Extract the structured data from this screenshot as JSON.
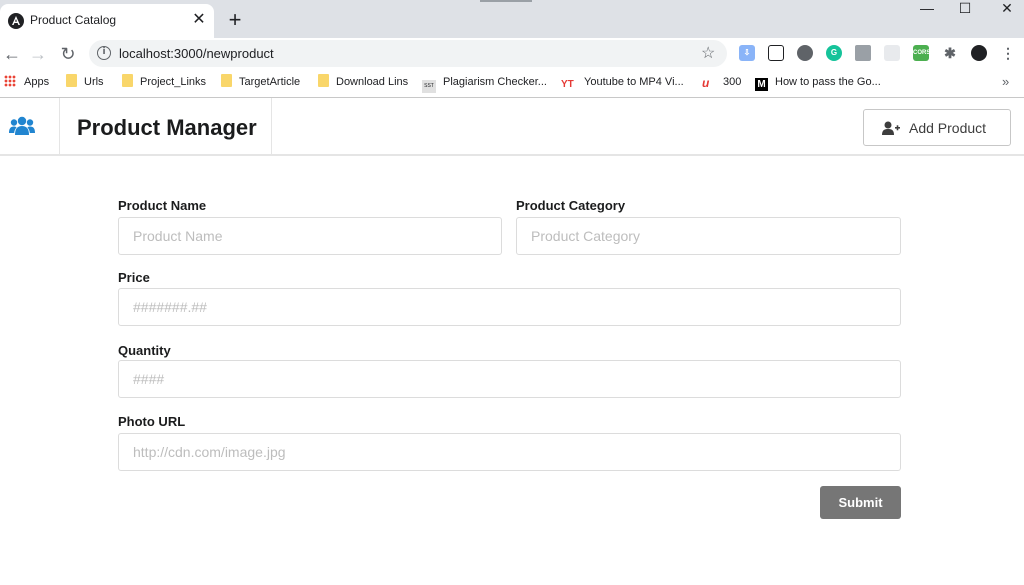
{
  "browser": {
    "tab_title": "Product Catalog",
    "tab_close": "✕",
    "new_tab": "+",
    "url": "localhost:3000/newproduct",
    "window_controls": {
      "minimize": "—",
      "maximize": "☐",
      "close": "✕"
    },
    "bookmarks": [
      {
        "label": "Apps",
        "icon": "apps-grid-icon"
      },
      {
        "label": "Urls",
        "icon": "folder-icon"
      },
      {
        "label": "Project_Links",
        "icon": "folder-icon"
      },
      {
        "label": "TargetArticle",
        "icon": "folder-icon"
      },
      {
        "label": "Download Lins",
        "icon": "folder-icon"
      },
      {
        "label": "Plagiarism Checker...",
        "icon": "sst-icon"
      },
      {
        "label": "Youtube to MP4 Vi...",
        "icon": "yt-icon"
      },
      {
        "label": "300",
        "icon": "bookmark-u-icon"
      },
      {
        "label": "How to pass the Go...",
        "icon": "medium-icon"
      }
    ],
    "more_bookmarks": "»"
  },
  "app": {
    "title": "Product Manager",
    "add_button_label": "Add Product",
    "accent": "#2185d0"
  },
  "form": {
    "product_name": {
      "label": "Product Name",
      "placeholder": "Product Name",
      "value": ""
    },
    "product_category": {
      "label": "Product Category",
      "placeholder": "Product Category",
      "value": ""
    },
    "price": {
      "label": "Price",
      "placeholder": "#######.##",
      "value": ""
    },
    "quantity": {
      "label": "Quantity",
      "placeholder": "####",
      "value": ""
    },
    "photo_url": {
      "label": "Photo URL",
      "placeholder": "http://cdn.com/image.jpg",
      "value": ""
    },
    "submit_label": "Submit"
  }
}
